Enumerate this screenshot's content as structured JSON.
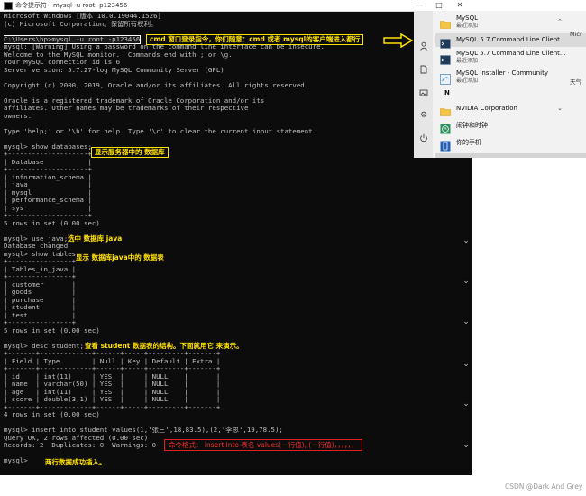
{
  "window": {
    "title": "命令提示符 - mysql -u root -p123456",
    "min_glyph": "—",
    "max_glyph": "□",
    "close_glyph": "✕"
  },
  "console": {
    "lines": [
      "Microsoft Windows [版本 10.0.19044.1526]",
      "(c) Microsoft Corporation。保留所有权利。",
      "",
      "C:\\Users\\hp>mysql -u root -p123456",
      "mysql: [Warning] Using a password on the command line interface can be insecure.",
      "Welcome to the MySQL monitor.  Commands end with ; or \\g.",
      "Your MySQL connection id is 6",
      "Server version: 5.7.27-log MySQL Community Server (GPL)",
      "",
      "Copyright (c) 2000, 2019, Oracle and/or its affiliates. All rights reserved.",
      "",
      "Oracle is a registered trademark of Oracle Corporation and/or its",
      "affiliates. Other names may be trademarks of their respective",
      "owners.",
      "",
      "Type 'help;' or '\\h' for help. Type '\\c' to clear the current input statement.",
      "",
      "mysql> show databases;",
      "+--------------------+",
      "| Database           |",
      "+--------------------+",
      "| information_schema |",
      "| java               |",
      "| mysql              |",
      "| performance_schema |",
      "| sys                |",
      "+--------------------+",
      "5 rows in set (0.00 sec)",
      "",
      "mysql> use java;",
      "Database changed",
      "mysql> show tables;",
      "+----------------+",
      "| Tables_in_java |",
      "+----------------+",
      "| customer       |",
      "| goods          |",
      "| purchase       |",
      "| student        |",
      "| test           |",
      "+----------------+",
      "5 rows in set (0.00 sec)",
      "",
      "mysql> desc student;",
      "+-------+-------------+------+-----+---------+-------+",
      "| Field | Type        | Null | Key | Default | Extra |",
      "+-------+-------------+------+-----+---------+-------+",
      "| id    | int(11)     | YES  |     | NULL    |       |",
      "| name  | varchar(50) | YES  |     | NULL    |       |",
      "| age   | int(11)     | YES  |     | NULL    |       |",
      "| score | double(3,1) | YES  |     | NULL    |       |",
      "+-------+-------------+------+-----+---------+-------+",
      "4 rows in set (0.00 sec)",
      "",
      "mysql> insert into student values(1,'张三',18,83.5),(2,'李思',19,78.5);",
      "Query OK, 2 rows affected (0.00 sec)",
      "Records: 2  Duplicates: 0  Warnings: 0",
      "",
      "mysql>"
    ]
  },
  "annotations": {
    "cmd_login": "cmd 窗口登录指令，你们随意：cmd 或者 mysql的客户端进入都行",
    "show_db": "显示服务器中的 数据库",
    "use_java": "选中 数据库 java",
    "show_tables": "显示 数据库java中的 数据表",
    "desc_student": "查看 student 数据表的结构。下面就用它 来演示。",
    "insert_format": "命令格式： insert into 表名 values(一行值), (一行值)，，，，，，",
    "inserted_ok": "两行数据成功插入。"
  },
  "start_menu": {
    "items": [
      {
        "title": "MySQL",
        "sub": "最近添加"
      },
      {
        "title": "MySQL 5.7 Command Line Client",
        "sub": ""
      },
      {
        "title": "MySQL 5.7 Command Line Client...",
        "sub": "最近添加"
      },
      {
        "title": "MySQL Installer - Community",
        "sub": "最近添加"
      },
      {
        "letter": "N"
      },
      {
        "title": "NVIDIA Corporation",
        "sub": ""
      },
      {
        "title": "闹钟和时钟",
        "sub": ""
      },
      {
        "title": "你的手机",
        "sub": ""
      }
    ],
    "cut_text_1": "Micr",
    "cut_text_2": "天气"
  },
  "watermark": "CSDN @Dark And Grey",
  "colors": {
    "console_bg": "#0c0c0c",
    "console_text": "#c0c0c0",
    "annotation_yellow": "#ffe100",
    "annotation_red": "#ff3030"
  }
}
